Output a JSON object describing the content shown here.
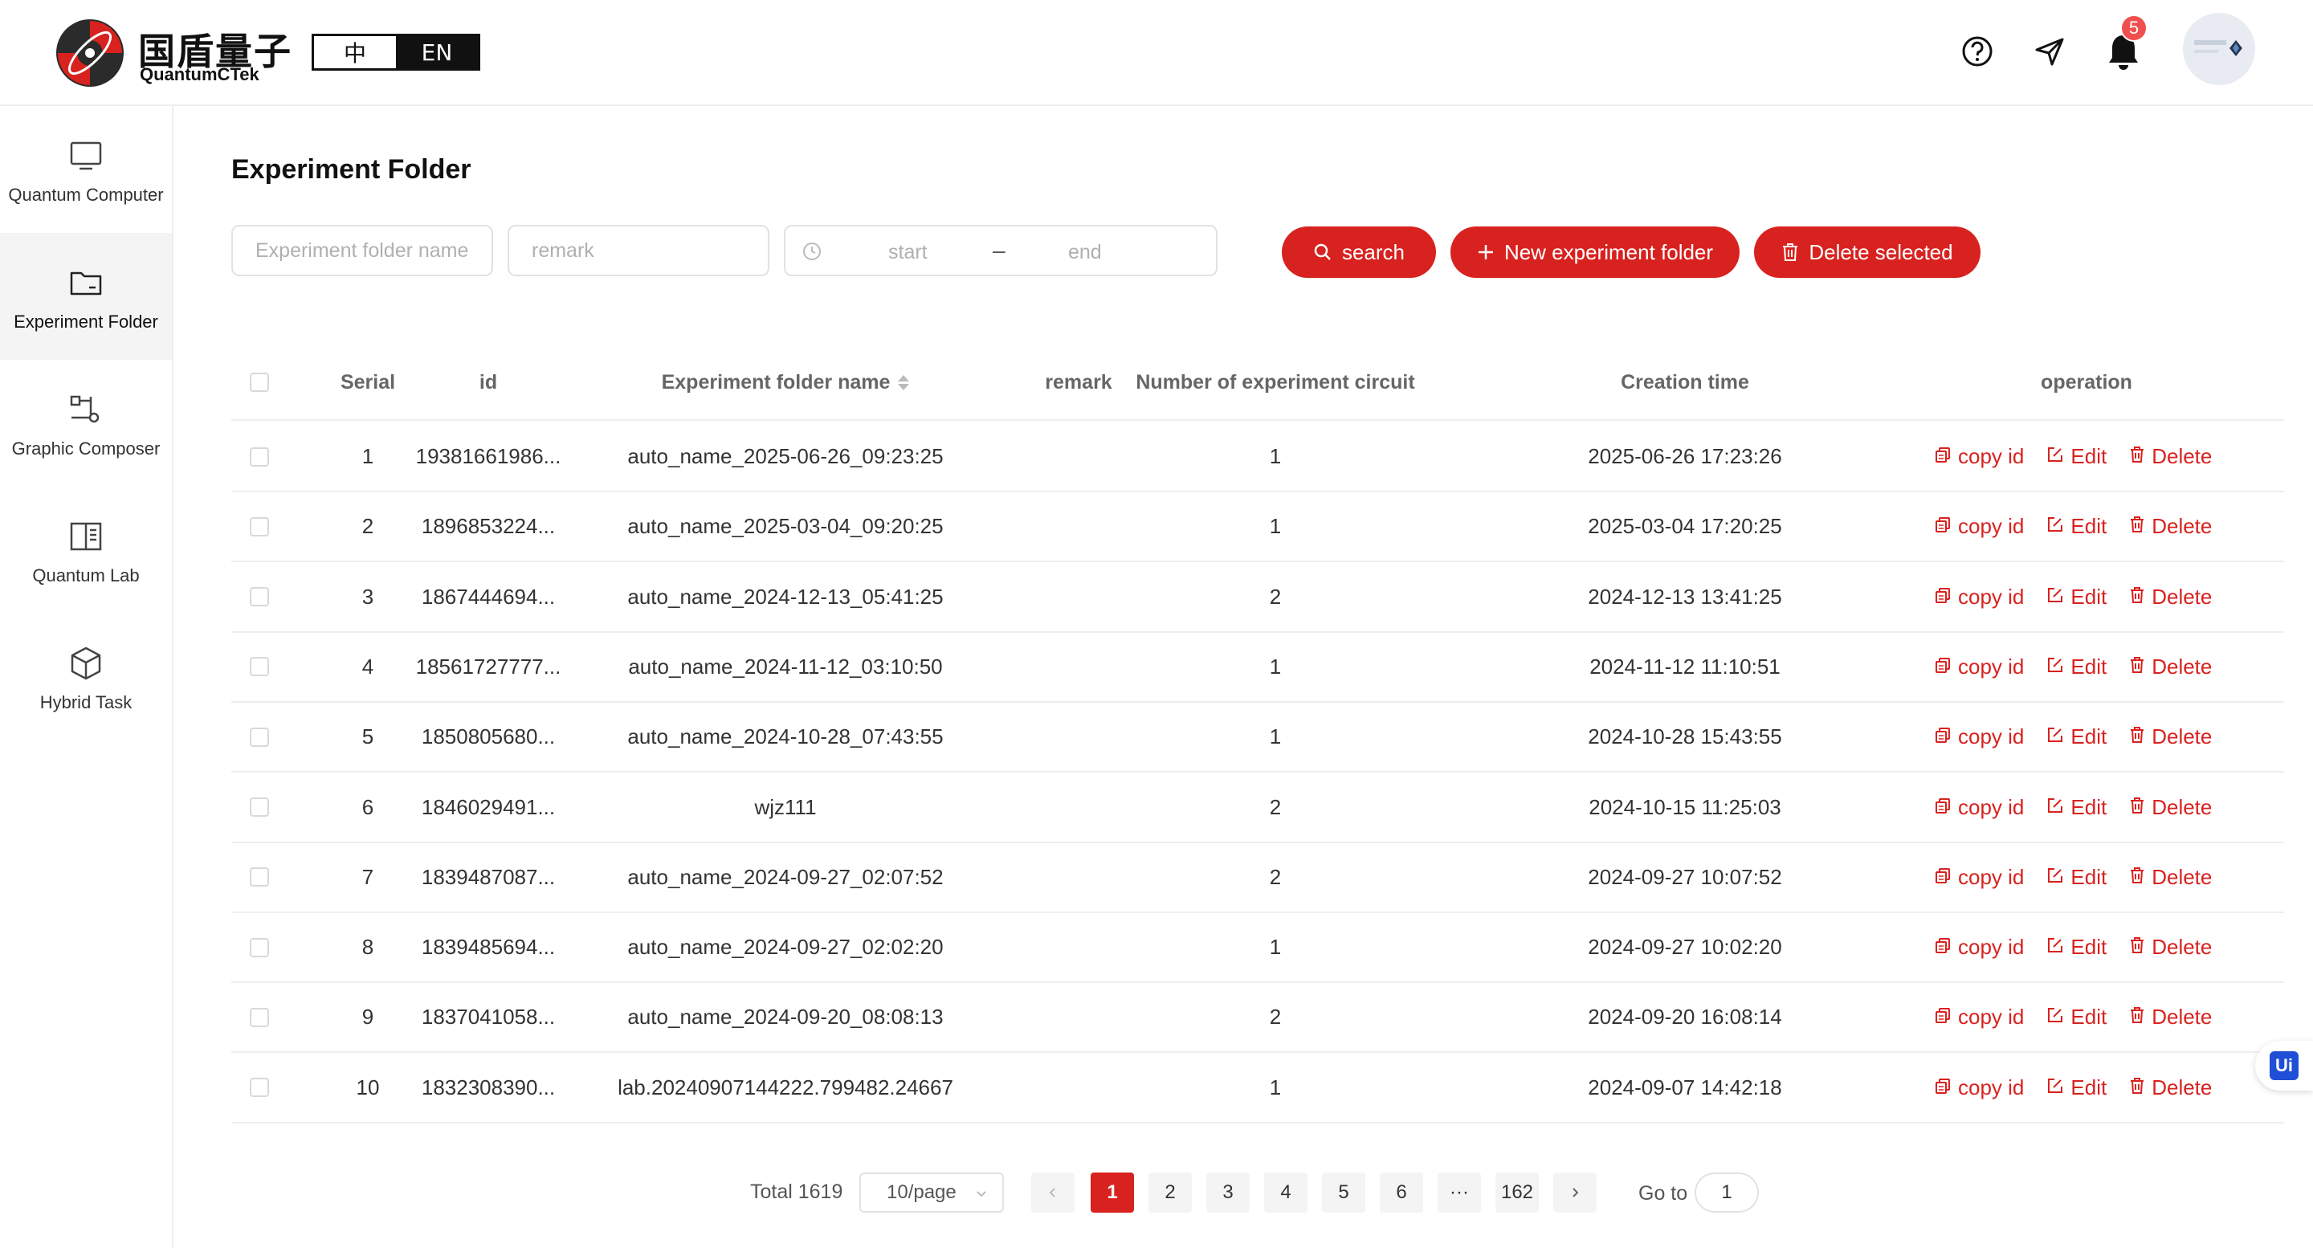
{
  "header": {
    "logo_cn": "国盾量子",
    "logo_en": "QuantumCTek",
    "lang_zh": "中",
    "lang_en": "EN",
    "notification_count": "5",
    "icons": [
      "help-icon",
      "send-icon",
      "bell-icon"
    ]
  },
  "sidebar": {
    "items": [
      {
        "label": "Quantum Computer",
        "icon": "monitor-icon",
        "active": false
      },
      {
        "label": "Experiment Folder",
        "icon": "folder-icon",
        "active": true
      },
      {
        "label": "Graphic Composer",
        "icon": "circuit-icon",
        "active": false
      },
      {
        "label": "Quantum Lab",
        "icon": "book-icon",
        "active": false
      },
      {
        "label": "Hybrid Task",
        "icon": "cube-icon",
        "active": false
      }
    ]
  },
  "main": {
    "title": "Experiment Folder",
    "filters": {
      "name_placeholder": "Experiment folder name",
      "remark_placeholder": "remark",
      "start_placeholder": "start",
      "range_separator": "–",
      "end_placeholder": "end"
    },
    "buttons": {
      "search": "search",
      "new_folder": "New experiment folder",
      "delete_selected": "Delete selected"
    }
  },
  "table": {
    "headers": {
      "serial": "Serial",
      "id": "id",
      "name": "Experiment folder name",
      "remark": "remark",
      "circuits": "Number of experiment circuit",
      "created": "Creation time",
      "operation": "operation"
    },
    "op_labels": {
      "copy": "copy id",
      "edit": "Edit",
      "delete": "Delete"
    },
    "rows": [
      {
        "serial": "1",
        "id": "19381661986...",
        "name": "auto_name_2025-06-26_09:23:25",
        "remark": "",
        "circuits": "1",
        "created": "2025-06-26 17:23:26"
      },
      {
        "serial": "2",
        "id": "1896853224...",
        "name": "auto_name_2025-03-04_09:20:25",
        "remark": "",
        "circuits": "1",
        "created": "2025-03-04 17:20:25"
      },
      {
        "serial": "3",
        "id": "1867444694...",
        "name": "auto_name_2024-12-13_05:41:25",
        "remark": "",
        "circuits": "2",
        "created": "2024-12-13 13:41:25"
      },
      {
        "serial": "4",
        "id": "18561727777...",
        "name": "auto_name_2024-11-12_03:10:50",
        "remark": "",
        "circuits": "1",
        "created": "2024-11-12 11:10:51"
      },
      {
        "serial": "5",
        "id": "1850805680...",
        "name": "auto_name_2024-10-28_07:43:55",
        "remark": "",
        "circuits": "1",
        "created": "2024-10-28 15:43:55"
      },
      {
        "serial": "6",
        "id": "1846029491...",
        "name": "wjz111",
        "remark": "",
        "circuits": "2",
        "created": "2024-10-15 11:25:03"
      },
      {
        "serial": "7",
        "id": "1839487087...",
        "name": "auto_name_2024-09-27_02:07:52",
        "remark": "",
        "circuits": "2",
        "created": "2024-09-27 10:07:52"
      },
      {
        "serial": "8",
        "id": "1839485694...",
        "name": "auto_name_2024-09-27_02:02:20",
        "remark": "",
        "circuits": "1",
        "created": "2024-09-27 10:02:20"
      },
      {
        "serial": "9",
        "id": "1837041058...",
        "name": "auto_name_2024-09-20_08:08:13",
        "remark": "",
        "circuits": "2",
        "created": "2024-09-20 16:08:14"
      },
      {
        "serial": "10",
        "id": "1832308390...",
        "name": "lab.20240907144222.799482.24667",
        "remark": "",
        "circuits": "1",
        "created": "2024-09-07 14:42:18"
      }
    ]
  },
  "pagination": {
    "total": "Total 1619",
    "page_size": "10/page",
    "pages": [
      "1",
      "2",
      "3",
      "4",
      "5",
      "6",
      "···",
      "162"
    ],
    "current": "1",
    "goto_label": "Go to",
    "goto_value": "1"
  },
  "float_badge": "Ui",
  "colors": {
    "accent": "#d8221f",
    "badge": "#f0504d"
  }
}
